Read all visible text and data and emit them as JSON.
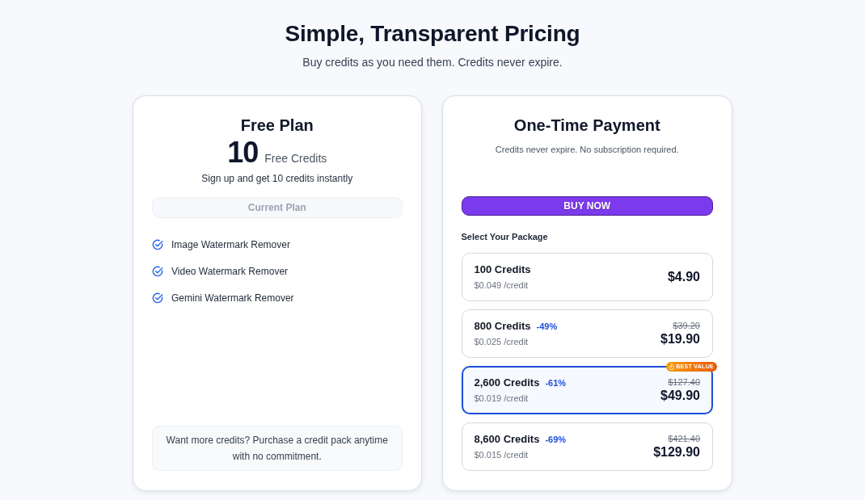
{
  "header": {
    "title": "Simple, Transparent Pricing",
    "subtitle": "Buy credits as you need them. Credits never expire."
  },
  "free_plan": {
    "title": "Free Plan",
    "amount": "10",
    "amount_label": "Free Credits",
    "description": "Sign up and get 10 credits instantly",
    "button": {
      "label": "Current Plan",
      "disabled": true
    },
    "features": [
      "Image Watermark Remover",
      "Video Watermark Remover",
      "Gemini Watermark Remover"
    ],
    "note": "Want more credits? Purchase a credit pack anytime with no commitment."
  },
  "payment": {
    "title": "One-Time Payment",
    "subtitle": "Credits never expire. No subscription required.",
    "button": {
      "label": "BUY NOW"
    },
    "section_label": "Select Your Package",
    "packages": [
      {
        "name": "100 Credits",
        "per_credit": "$0.049 /credit",
        "price": "$4.90",
        "selected": false
      },
      {
        "name": "800 Credits",
        "discount": "-49%",
        "per_credit": "$0.025 /credit",
        "old_price": "$39.20",
        "price": "$19.90",
        "selected": false
      },
      {
        "name": "2,600 Credits",
        "discount": "-61%",
        "per_credit": "$0.019 /credit",
        "old_price": "$127.40",
        "price": "$49.90",
        "selected": true,
        "badge": "BEST VALUE"
      },
      {
        "name": "8,600 Credits",
        "discount": "-69%",
        "per_credit": "$0.015 /credit",
        "old_price": "$421.40",
        "price": "$129.90",
        "selected": false
      }
    ]
  }
}
